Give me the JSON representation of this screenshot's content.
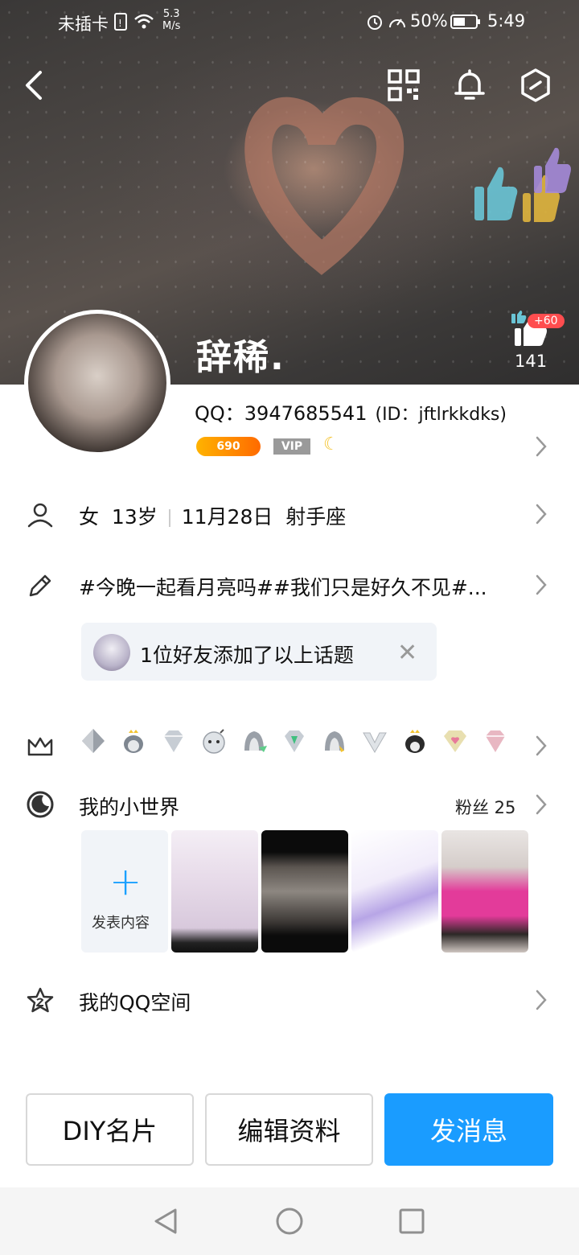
{
  "status_bar": {
    "carrier": "未插卡",
    "net_speed_value": "5.3",
    "net_speed_unit": "M/s",
    "battery": "50%",
    "time": "5:49"
  },
  "header": {
    "nickname": "辞稀.",
    "like_increment": "+60",
    "like_count": "141"
  },
  "profile": {
    "qq_label": "QQ：3947685541",
    "id_label": "(ID：jftlrkkdks)",
    "coin_value": "690",
    "vip_label": "VIP"
  },
  "info_row": {
    "gender": "女",
    "age": "13岁",
    "birthday": "11月28日",
    "zodiac": "射手座"
  },
  "signature": {
    "text": "#今晚一起看月亮吗##我们只是好久不见#..."
  },
  "topic_chip": {
    "text": "1位好友添加了以上话题"
  },
  "world": {
    "title": "我的小世界",
    "fans": "粉丝 25",
    "add_label": "发表内容"
  },
  "qzone": {
    "title": "我的QQ空间"
  },
  "actions": {
    "diy": "DIY名片",
    "edit": "编辑资料",
    "message": "发消息"
  },
  "colors": {
    "primary": "#1a9cff",
    "coin": "#ff8a00",
    "like_badge": "#ff4d4f"
  }
}
